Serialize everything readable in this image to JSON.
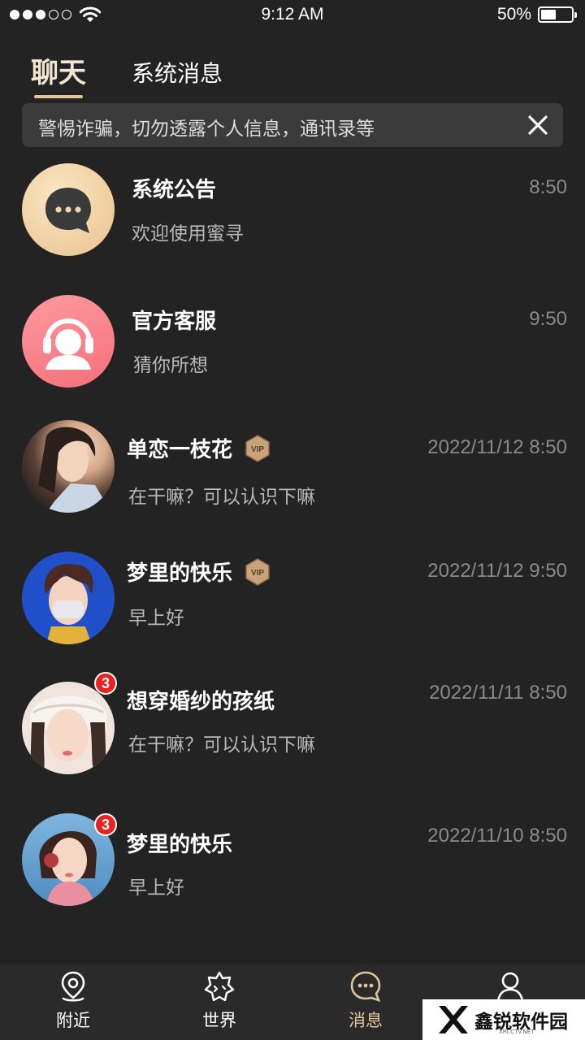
{
  "status_bar": {
    "time": "9:12 AM",
    "battery_percent": "50%",
    "battery_level": 0.5,
    "signal_dots": [
      true,
      true,
      true,
      false,
      false
    ]
  },
  "tabs": {
    "chat": "聊天",
    "system": "系统消息"
  },
  "warning": {
    "text": "警惕诈骗，切勿透露个人信息，通讯录等"
  },
  "conversations": [
    {
      "name": "系统公告",
      "message": "欢迎使用蜜寻",
      "time": "8:50",
      "vip": false,
      "badge": ""
    },
    {
      "name": "官方客服",
      "message": "猜你所想",
      "time": "9:50",
      "vip": false,
      "badge": ""
    },
    {
      "name": "单恋一枝花",
      "message": "在干嘛？可以认识下嘛",
      "time": "2022/11/12 8:50",
      "vip": true,
      "badge": ""
    },
    {
      "name": "梦里的快乐",
      "message": "早上好",
      "time": "2022/11/12 9:50",
      "vip": true,
      "badge": ""
    },
    {
      "name": "想穿婚纱的孩纸",
      "message": "在干嘛？可以认识下嘛",
      "time": "2022/11/11 8:50",
      "vip": false,
      "badge": "3"
    },
    {
      "name": "梦里的快乐",
      "message": "早上好",
      "time": "2022/11/10 8:50",
      "vip": false,
      "badge": "3"
    }
  ],
  "vip_label": "VIP",
  "nav": {
    "nearby": "附近",
    "world": "世界",
    "messages": "消息",
    "me": ""
  },
  "watermark": {
    "text": "鑫锐软件园",
    "sub": "XRCCTV.NET"
  },
  "colors": {
    "background": "#232323",
    "accent": "#e0c49c",
    "badge": "#e8221f"
  }
}
